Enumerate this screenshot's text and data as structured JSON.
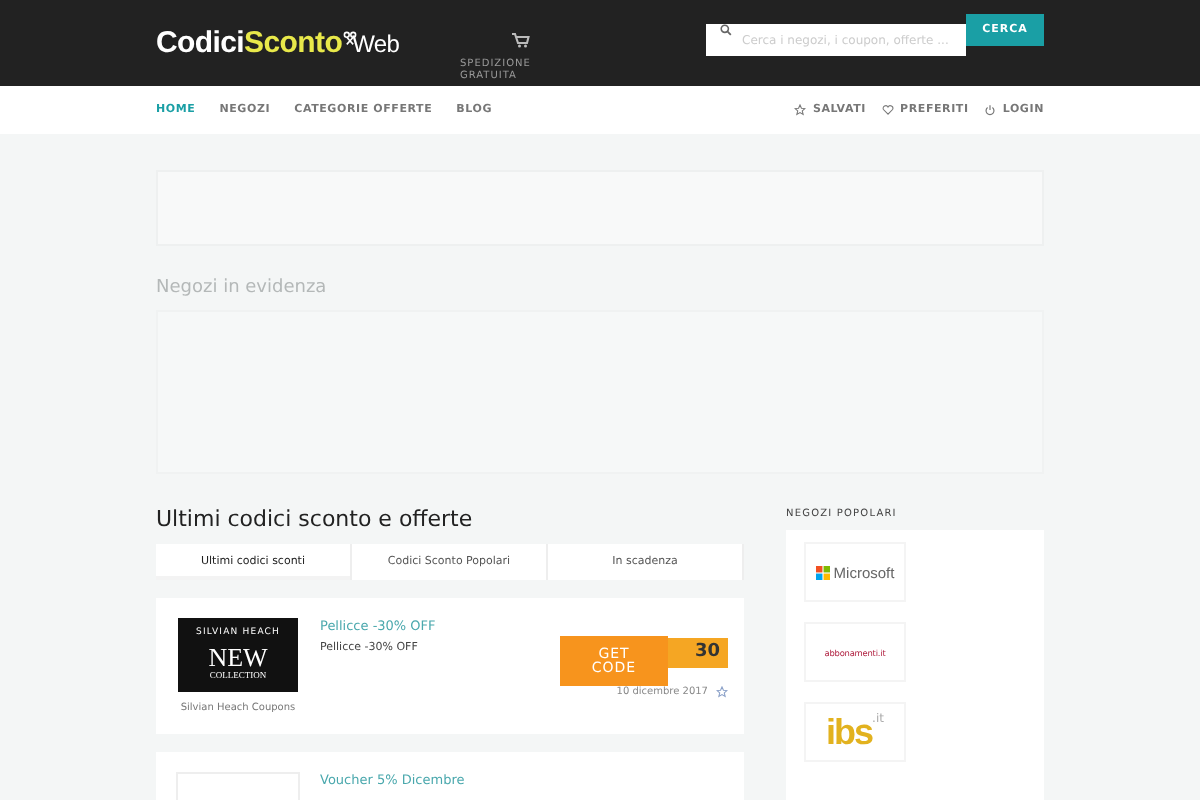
{
  "header": {
    "logo": {
      "part_1": "Codici",
      "part_2": "Sconto",
      "part_3": "Web"
    },
    "shipping": "SPEDIZIONE GRATUITA",
    "search": {
      "placeholder": "Cerca i negozi, i coupon, offerte ..."
    },
    "search_button": "CERCA"
  },
  "nav": {
    "items": [
      {
        "label": "HOME",
        "selected": true
      },
      {
        "label": "NEGOZI",
        "selected": false
      },
      {
        "label": "CATEGORIE OFFERTE",
        "selected": false
      },
      {
        "label": "BLOG",
        "selected": false
      }
    ],
    "right_items": [
      {
        "label": "SALVATI",
        "kind": "star"
      },
      {
        "label": "PREFERITI",
        "kind": "heart"
      },
      {
        "label": "LOGIN",
        "kind": "power"
      }
    ]
  },
  "featured_title": "Negozi in evidenza",
  "coupons": {
    "title": "Ultimi codici sconto e offerte",
    "tabs": [
      {
        "label": "Ultimi codici sconti",
        "selected": true
      },
      {
        "label": "Codici Sconto Popolari",
        "selected": false
      },
      {
        "label": "In scadenza",
        "selected": false
      }
    ],
    "items": [
      {
        "logo_lines": [
          "SILVIAN HEACH",
          "NEW",
          "COLLECTION"
        ],
        "store": "Silvian Heach Coupons",
        "title": "Pellicce -30% OFF",
        "description": "Pellicce -30% OFF",
        "button": "GET CODE",
        "code": "30",
        "expires": "10 dicembre 2017"
      },
      {
        "title": "Voucher  5% Dicembre"
      }
    ]
  },
  "sidebar": {
    "title": "NEGOZI POPOLARI",
    "stores": [
      {
        "name": "Microsoft",
        "kind": "microsoft"
      },
      {
        "name": "abbonamenti.it",
        "kind": "abbonamenti"
      },
      {
        "name": "ibs",
        "suffix": ".it",
        "kind": "ibs"
      }
    ]
  }
}
